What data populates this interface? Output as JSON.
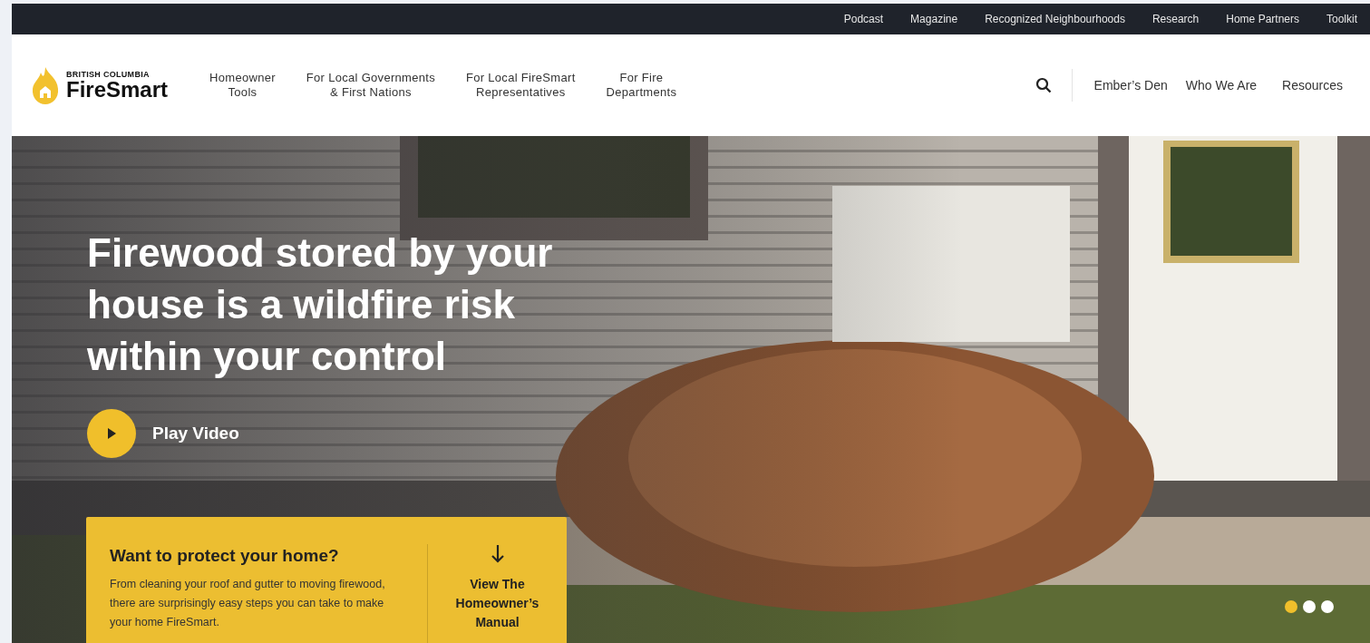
{
  "utility_nav": [
    "Podcast",
    "Magazine",
    "Recognized Neighbourhoods",
    "Research",
    "Home Partners",
    "Toolkit"
  ],
  "logo": {
    "top": "BRITISH COLUMBIA",
    "name": "FireSmart"
  },
  "main_nav": [
    {
      "lines": [
        "Homeowner",
        "Tools"
      ]
    },
    {
      "lines": [
        "For Local Governments",
        "& First Nations"
      ]
    },
    {
      "lines": [
        "For Local FireSmart",
        "Representatives"
      ]
    },
    {
      "lines": [
        "For Fire",
        "Departments"
      ]
    }
  ],
  "secondary_nav": [
    "Ember’s Den",
    "Who We Are",
    "Resources"
  ],
  "hero": {
    "headline": "Firewood stored by your house is a wildfire risk within your control",
    "play_label": "Play Video"
  },
  "callout": {
    "title": "Want to protect your home?",
    "body": "From cleaning your roof and gutter to moving firewood, there are surprisingly easy steps you can take to make your home FireSmart.",
    "link_lines": [
      "View The",
      "Homeowner’s",
      "Manual"
    ]
  },
  "slides": [
    {
      "selected": true
    },
    {
      "selected": false
    },
    {
      "selected": false
    }
  ]
}
